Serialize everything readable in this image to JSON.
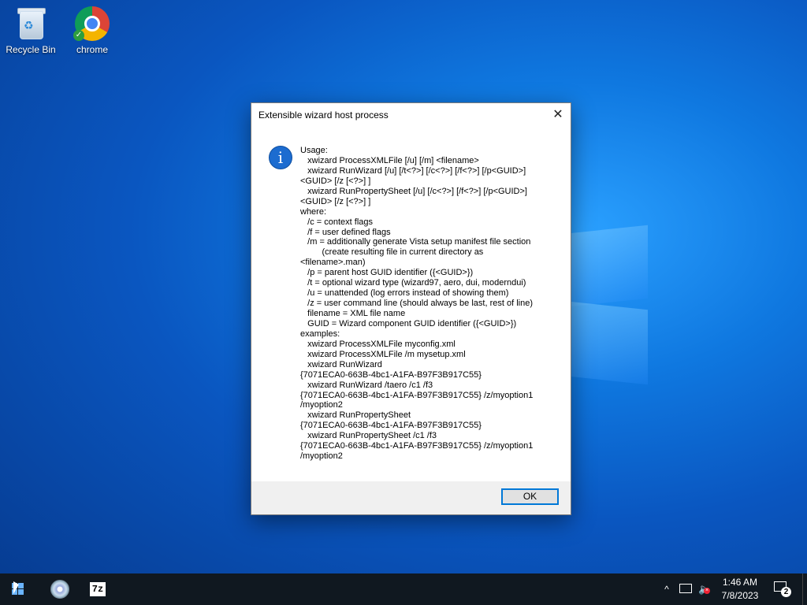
{
  "desktop": {
    "icons": [
      {
        "label": "Recycle Bin",
        "icon": "recycle-bin-icon"
      },
      {
        "label": "chrome",
        "icon": "chrome-icon"
      }
    ]
  },
  "dialog": {
    "title": "Extensible wizard host process",
    "close_glyph": "✕",
    "icon": "info-icon",
    "message_lines": [
      "Usage:",
      "   xwizard ProcessXMLFile [/u] [/m] <filename>",
      "   xwizard RunWizard [/u] [/t<?>] [/c<?>] [/f<?>] [/p<GUID>]",
      "<GUID> [/z [<?>] ]",
      "   xwizard RunPropertySheet [/u] [/c<?>] [/f<?>] [/p<GUID>]",
      "<GUID> [/z [<?>] ]",
      "where:",
      "   /c = context flags",
      "   /f = user defined flags",
      "   /m = additionally generate Vista setup manifest file section",
      "         (create resulting file in current directory as",
      "<filename>.man)",
      "   /p = parent host GUID identifier ({<GUID>})",
      "   /t = optional wizard type (wizard97, aero, dui, moderndui)",
      "   /u = unattended (log errors instead of showing them)",
      "   /z = user command line (should always be last, rest of line)",
      "   filename = XML file name",
      "   GUID = Wizard component GUID identifier ({<GUID>})",
      "examples:",
      "   xwizard ProcessXMLFile myconfig.xml",
      "   xwizard ProcessXMLFile /m mysetup.xml",
      "   xwizard RunWizard",
      "{7071ECA0-663B-4bc1-A1FA-B97F3B917C55}",
      "   xwizard RunWizard /taero /c1 /f3",
      "{7071ECA0-663B-4bc1-A1FA-B97F3B917C55} /z/myoption1",
      "/myoption2",
      "   xwizard RunPropertySheet",
      "{7071ECA0-663B-4bc1-A1FA-B97F3B917C55}",
      "   xwizard RunPropertySheet /c1 /f3",
      "{7071ECA0-663B-4bc1-A1FA-B97F3B917C55} /z/myoption1",
      "/myoption2"
    ],
    "ok_label": "OK"
  },
  "taskbar": {
    "apps": [
      "start-icon",
      "disc-app-icon",
      "7zip-icon"
    ],
    "seven_zip_text": "7z",
    "tray": {
      "chevron": "^",
      "volume_glyph": "🔈",
      "time": "1:46 AM",
      "date": "7/8/2023",
      "notification_count": "2"
    }
  }
}
